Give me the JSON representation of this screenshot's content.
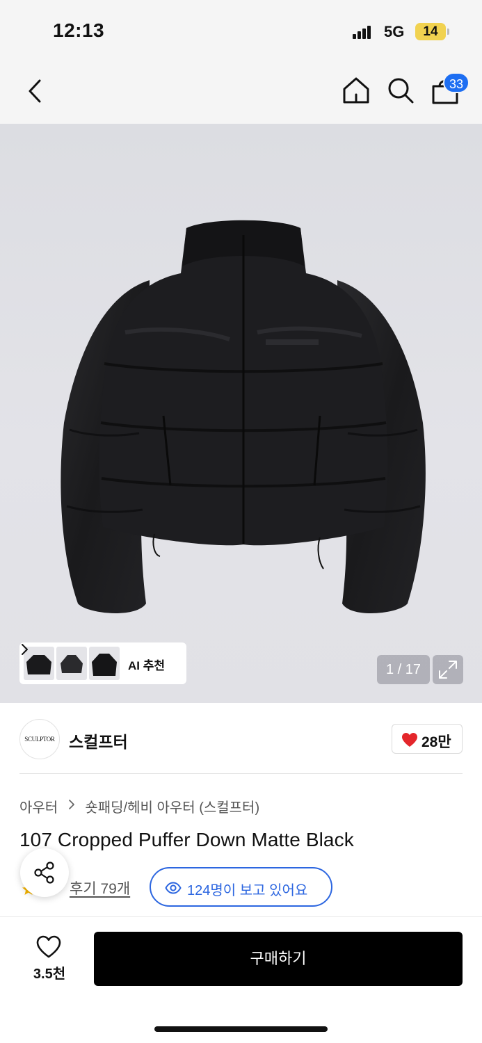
{
  "status_bar": {
    "time": "12:13",
    "network": "5G",
    "battery": "14"
  },
  "nav": {
    "icons": [
      "back-icon",
      "home-icon",
      "search-icon",
      "shopping-bag-icon"
    ],
    "cart_badge": "33"
  },
  "gallery": {
    "page_counter": "1 / 17",
    "ai_recommend_label": "AI 추천",
    "icons": [
      "chevron-right-icon",
      "expand-icon"
    ]
  },
  "brand": {
    "logo_text": "SCULPTOR",
    "name": "스컬프터",
    "like_count": "28만",
    "heart_color": "#e4262b"
  },
  "product": {
    "breadcrumb": [
      "아우터",
      "숏패딩/헤비 아우터 (스컬프터)"
    ],
    "title": "107 Cropped Puffer Down Matte Black",
    "review_label": "후기 79개",
    "viewers_text": "124명이 보고 있어요",
    "accent_color": "#2c66e0"
  },
  "bottom_bar": {
    "wish_count": "3.5천",
    "buy_label": "구매하기"
  }
}
